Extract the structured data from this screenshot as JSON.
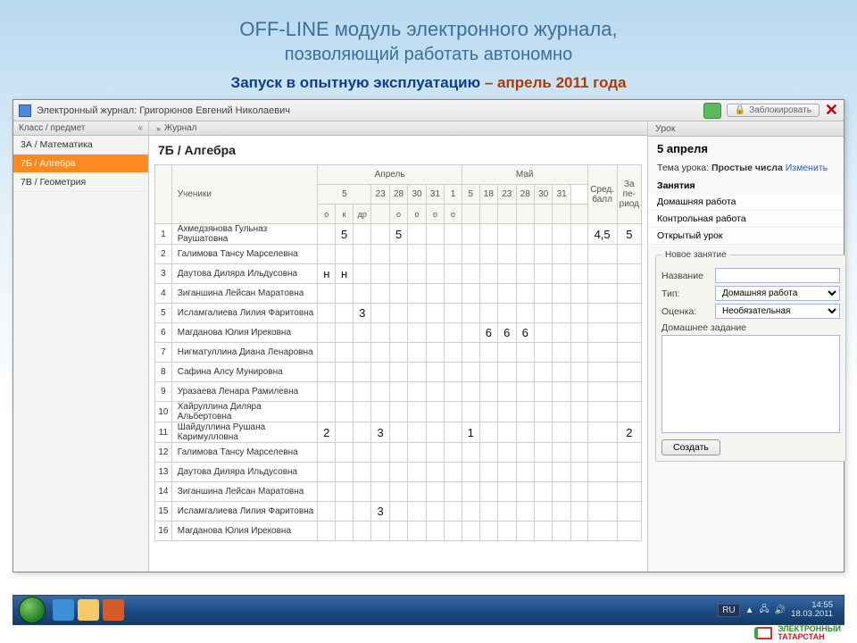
{
  "slide": {
    "title": "OFF-LINE модуль электронного журнала,",
    "subtitle": "позволяющий работать автономно",
    "note_part1": "Запуск в опытную эксплуатацию ",
    "note_part2": "– апрель 2011 года"
  },
  "titlebar": {
    "app_name": "Электронный журнал: Григорюнов Евгений Николаевич",
    "lock_label": "Заблокировать"
  },
  "sidebar": {
    "header": "Класс / предмет",
    "items": [
      {
        "label": "3А / Математика",
        "selected": false
      },
      {
        "label": "7Б / Алгебра",
        "selected": true
      },
      {
        "label": "7В / Геометрия",
        "selected": false
      }
    ]
  },
  "journal": {
    "tab_label": "Журнал",
    "class_title": "7Б / Алгебра",
    "students_header": "Ученики",
    "month1": "Апрель",
    "month2": "Май",
    "avg_header": "Сред. балл",
    "period_header": "За пе-риод",
    "april_subs": [
      "о",
      "к",
      "др",
      "",
      "о",
      "о",
      "о",
      "о"
    ],
    "april_days": [
      "5",
      "",
      "23",
      "28",
      "30",
      "31"
    ],
    "may_days": [
      "1",
      "5",
      "18",
      "23",
      "28",
      "30",
      "31"
    ],
    "rows": [
      {
        "n": "1",
        "name": "Ахмедзянова Гульназ Раушатовна",
        "cells": [
          "",
          "5",
          "",
          "",
          "5",
          "",
          "",
          "",
          "",
          "",
          "",
          "",
          "",
          ""
        ],
        "avg": "4,5",
        "per": "5"
      },
      {
        "n": "2",
        "name": "Галимова Тансу Марселевна",
        "cells": [
          "",
          "",
          "",
          "",
          "",
          "",
          "",
          "",
          "",
          "",
          "",
          "",
          "",
          ""
        ],
        "avg": "",
        "per": ""
      },
      {
        "n": "3",
        "name": "Даутова Диляра Ильдусовна",
        "cells": [
          "н",
          "н",
          "",
          "",
          "",
          "",
          "",
          "",
          "",
          "",
          "",
          "",
          "",
          ""
        ],
        "avg": "",
        "per": ""
      },
      {
        "n": "4",
        "name": "Зиганшина Лейсан Маратовна",
        "cells": [
          "",
          "",
          "",
          "",
          "",
          "",
          "",
          "",
          "",
          "",
          "",
          "",
          "",
          ""
        ],
        "avg": "",
        "per": ""
      },
      {
        "n": "5",
        "name": "Исламгалиева Лилия Фаритовна",
        "cells": [
          "",
          "",
          "3",
          "",
          "",
          "",
          "",
          "",
          "",
          "",
          "",
          "",
          "",
          ""
        ],
        "avg": "",
        "per": ""
      },
      {
        "n": "6",
        "name": "Магданова Юлия Ирековна",
        "cells": [
          "",
          "",
          "",
          "",
          "",
          "",
          "",
          "",
          "",
          "6",
          "6",
          "6",
          "",
          ""
        ],
        "avg": "",
        "per": ""
      },
      {
        "n": "7",
        "name": "Нигматуллина Диана Ленаровна",
        "cells": [
          "",
          "",
          "",
          "",
          "",
          "",
          "",
          "",
          "",
          "",
          "",
          "",
          "",
          ""
        ],
        "avg": "",
        "per": ""
      },
      {
        "n": "8",
        "name": "Сафина Алсу Мунировна",
        "cells": [
          "",
          "",
          "",
          "",
          "",
          "",
          "",
          "",
          "",
          "",
          "",
          "",
          "",
          ""
        ],
        "avg": "",
        "per": ""
      },
      {
        "n": "9",
        "name": "Уразаева Ленара Рамилевна",
        "cells": [
          "",
          "",
          "",
          "",
          "",
          "",
          "",
          "",
          "",
          "",
          "",
          "",
          "",
          ""
        ],
        "avg": "",
        "per": ""
      },
      {
        "n": "10",
        "name": "Хайруллина Диляра Альбертовна",
        "cells": [
          "",
          "",
          "",
          "",
          "",
          "",
          "",
          "",
          "",
          "",
          "",
          "",
          "",
          ""
        ],
        "avg": "",
        "per": ""
      },
      {
        "n": "11",
        "name": "Шайдуллина Рушана Каримулловна",
        "cells": [
          "2",
          "",
          "",
          "3",
          "",
          "",
          "",
          "",
          "1",
          "",
          "",
          "",
          "",
          ""
        ],
        "avg": "",
        "per": "2"
      },
      {
        "n": "12",
        "name": "Галимова Тансу Марселевна",
        "cells": [
          "",
          "",
          "",
          "",
          "",
          "",
          "",
          "",
          "",
          "",
          "",
          "",
          "",
          ""
        ],
        "avg": "",
        "per": ""
      },
      {
        "n": "13",
        "name": "Даутова Диляра Ильдусовна",
        "cells": [
          "",
          "",
          "",
          "",
          "",
          "",
          "",
          "",
          "",
          "",
          "",
          "",
          "",
          ""
        ],
        "avg": "",
        "per": ""
      },
      {
        "n": "14",
        "name": "Зиганшина Лейсан Маратовна",
        "cells": [
          "",
          "",
          "",
          "",
          "",
          "",
          "",
          "",
          "",
          "",
          "",
          "",
          "",
          ""
        ],
        "avg": "",
        "per": ""
      },
      {
        "n": "15",
        "name": "Исламгалиева Лилия Фаритовна",
        "cells": [
          "",
          "",
          "",
          "3",
          "",
          "",
          "",
          "",
          "",
          "",
          "",
          "",
          "",
          ""
        ],
        "avg": "",
        "per": ""
      },
      {
        "n": "16",
        "name": "Магданова Юлия Ирековна",
        "cells": [
          "",
          "",
          "",
          "",
          "",
          "",
          "",
          "",
          "",
          "",
          "",
          "",
          "",
          ""
        ],
        "avg": "",
        "per": ""
      }
    ]
  },
  "lesson": {
    "tab_label": "Урок",
    "date": "5 апреля",
    "topic_label": "Тема урока:",
    "topic_value": "Простые числа",
    "change_link": "Изменить",
    "tasks_header": "Занятия",
    "tasks": [
      "Домашняя работа",
      "Контрольная работа",
      "Открытый урок"
    ],
    "new_task_legend": "Новое занятие",
    "form": {
      "name_label": "Название",
      "type_label": "Тип:",
      "type_value": "Домашняя работа",
      "grade_label": "Оценка:",
      "grade_value": "Необязательная",
      "hw_label": "Домашнее задание",
      "create_btn": "Создать"
    }
  },
  "taskbar": {
    "lang": "RU",
    "time": "14:55",
    "date": "18.03.2011"
  },
  "brand": {
    "line1": "ЭЛЕКТРОННЫЙ",
    "line2": "ТАТАРСТАН"
  }
}
